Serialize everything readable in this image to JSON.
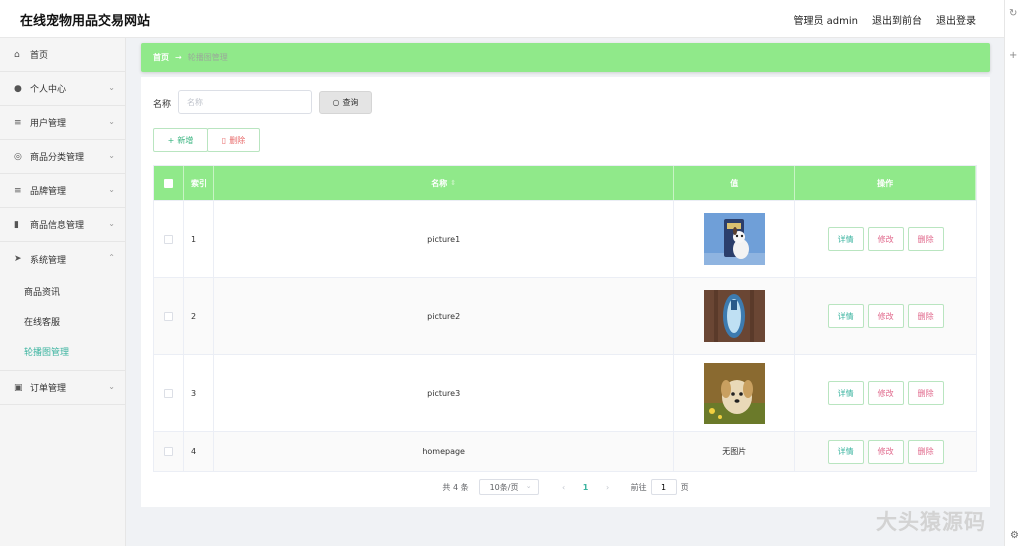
{
  "header": {
    "title": "在线宠物用品交易网站",
    "user": "管理员 admin",
    "front_link": "退出到前台",
    "logout": "退出登录"
  },
  "sidebar": {
    "items": [
      {
        "label": "首页",
        "icon": "home-icon",
        "glyph": "⌂",
        "chevron": false
      },
      {
        "label": "个人中心",
        "icon": "user-icon",
        "glyph": "●",
        "chevron": true
      },
      {
        "label": "用户管理",
        "icon": "list-icon",
        "glyph": "≡",
        "chevron": true
      },
      {
        "label": "商品分类管理",
        "icon": "category-icon",
        "glyph": "◎",
        "chevron": true
      },
      {
        "label": "品牌管理",
        "icon": "list-icon",
        "glyph": "≡",
        "chevron": true
      },
      {
        "label": "商品信息管理",
        "icon": "bar-chart-icon",
        "glyph": "▮",
        "chevron": true
      },
      {
        "label": "系统管理",
        "icon": "send-icon",
        "glyph": "➤",
        "chevron": true
      }
    ],
    "system_sub": [
      "商品资讯",
      "在线客服",
      "轮播图管理"
    ],
    "last_item": {
      "label": "订单管理",
      "icon": "clipboard-icon",
      "glyph": "▣"
    }
  },
  "breadcrumb": {
    "home": "首页",
    "separator": "→",
    "current": "轮播图管理"
  },
  "search": {
    "label": "名称",
    "placeholder": "名称",
    "value": "",
    "button": "查询"
  },
  "actions": {
    "add": "新增",
    "delete": "删除"
  },
  "table": {
    "columns": {
      "index": "索引",
      "name": "名称",
      "value": "值",
      "ops": "操作"
    },
    "rows": [
      {
        "index": "1",
        "name": "picture1",
        "has_image": true
      },
      {
        "index": "2",
        "name": "picture2",
        "has_image": true
      },
      {
        "index": "3",
        "name": "picture3",
        "has_image": true
      },
      {
        "index": "4",
        "name": "homepage",
        "has_image": false,
        "value_text": "无图片"
      }
    ],
    "op_labels": {
      "detail": "详情",
      "edit": "修改",
      "delete": "删除"
    }
  },
  "pagination": {
    "total": "共 4 条",
    "page_size": "10条/页",
    "current_page": "1",
    "goto_label": "前往",
    "goto_value": "1",
    "goto_suffix": "页"
  },
  "watermark": "大头猿源码",
  "colors": {
    "accent_green": "#90e98a",
    "teal": "#3cb4a0",
    "pink": "#e0668a"
  }
}
